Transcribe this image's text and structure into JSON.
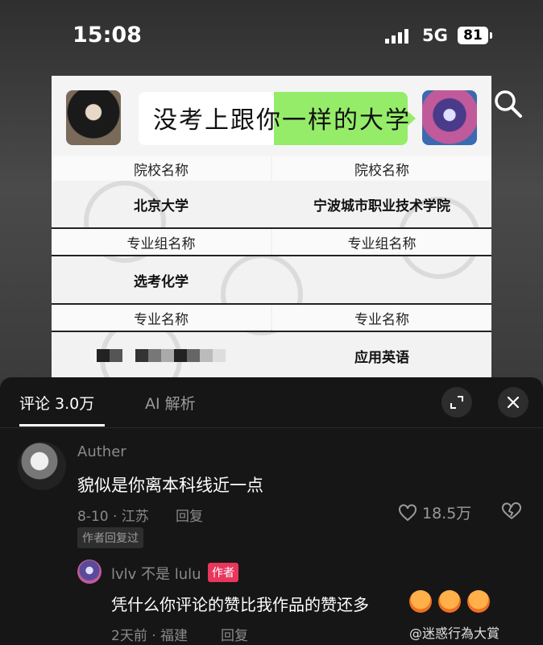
{
  "status_bar": {
    "time": "15:08",
    "network": "5G",
    "battery": "81"
  },
  "card": {
    "bubble_text": "没考上跟你一样的大学",
    "left": {
      "school_label": "院校名称",
      "school_value": "北京大学",
      "major_group_label": "专业组名称",
      "major_group_value": "选考化学",
      "major_label": "专业名称"
    },
    "right": {
      "school_label": "院校名称",
      "school_value": "宁波城市职业技术学院",
      "major_group_label": "专业组名称",
      "major_label": "专业名称",
      "major_value": "应用英语"
    }
  },
  "comments": {
    "tabs": [
      {
        "label": "评论 3.0万"
      },
      {
        "label": "AI 解析"
      }
    ],
    "main": {
      "author": "Auther",
      "text": "貌似是你离本科线近一点",
      "meta": "8-10 · 江苏",
      "reply_label": "回复",
      "likes": "18.5万",
      "author_replied_tag": "作者回复过"
    },
    "reply": {
      "author": "lvlv 不是 lulu",
      "badge": "作者",
      "text": "凭什么你评论的赞比我作品的赞还多",
      "meta": "2天前 · 福建",
      "reply_label": "回复"
    }
  },
  "watermark_text": "@迷惑行為大賞"
}
